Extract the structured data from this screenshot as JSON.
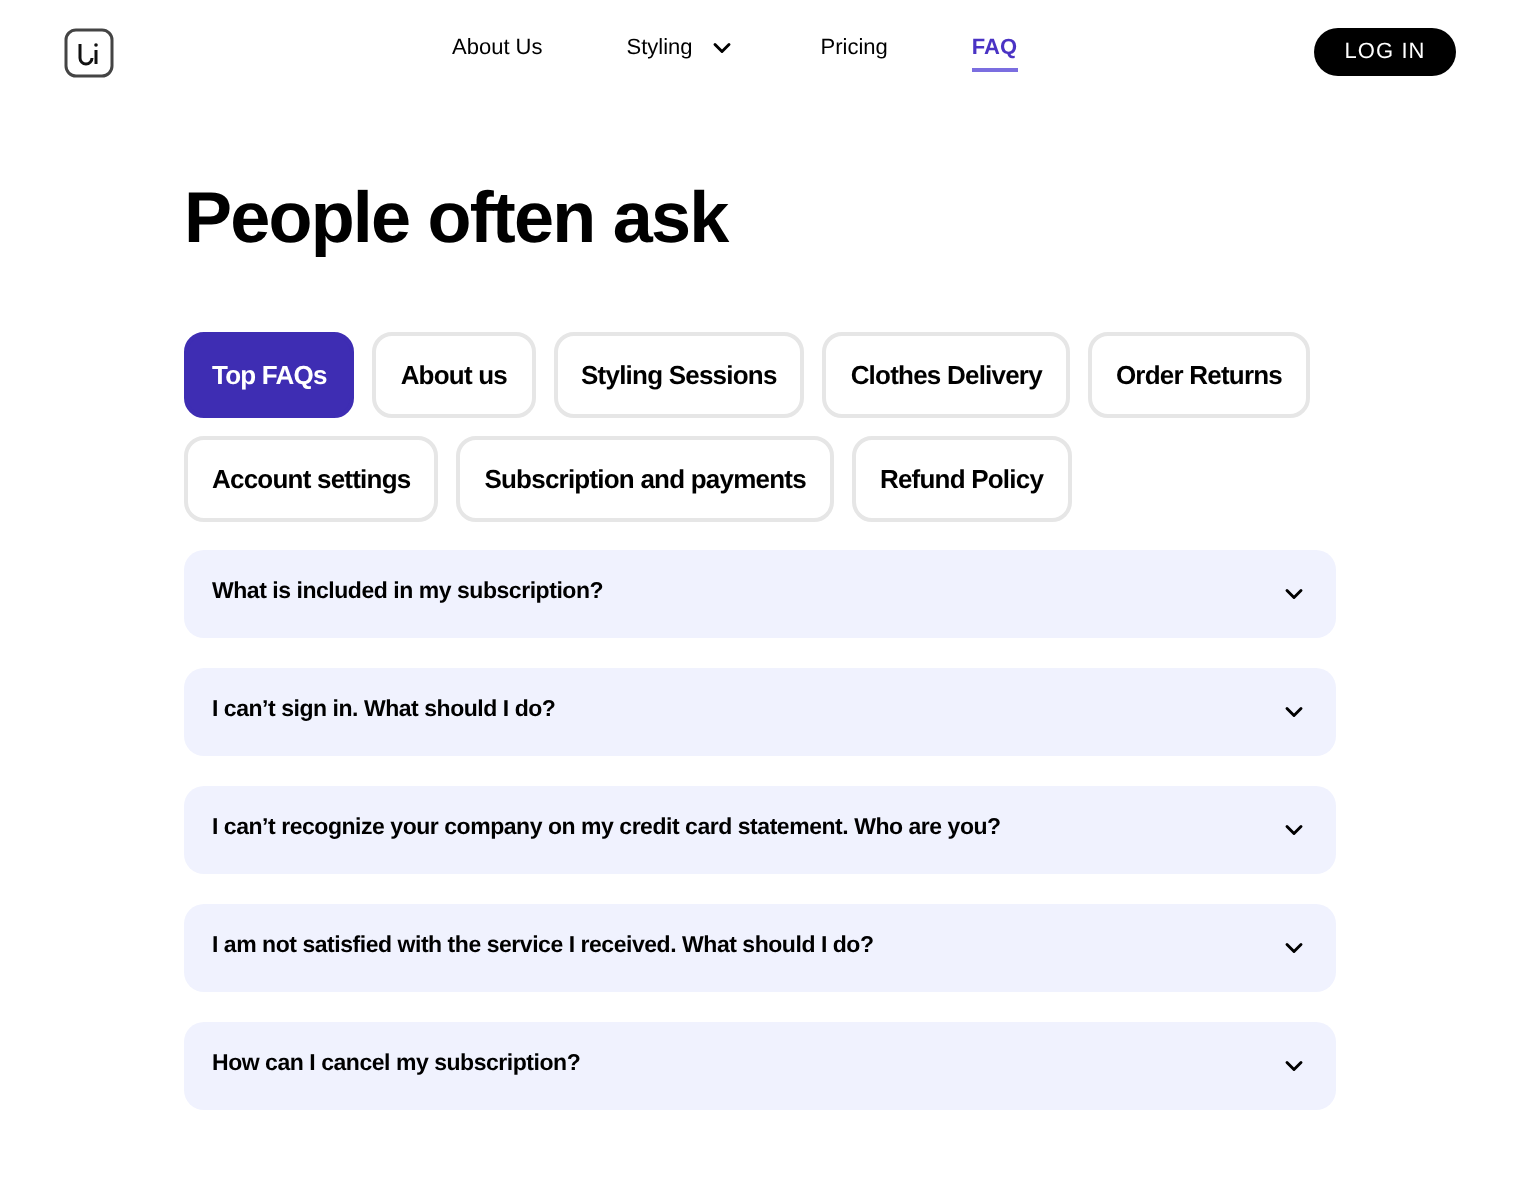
{
  "nav": {
    "links": [
      {
        "label": "About Us",
        "selected": false,
        "dropdown": false
      },
      {
        "label": "Styling",
        "selected": false,
        "dropdown": true
      },
      {
        "label": "Pricing",
        "selected": false,
        "dropdown": false
      },
      {
        "label": "FAQ",
        "selected": true,
        "dropdown": false
      }
    ],
    "login": "LOG IN"
  },
  "heading": "People often ask",
  "tabs": [
    {
      "label": "Top FAQs",
      "selected": true
    },
    {
      "label": "About us",
      "selected": false
    },
    {
      "label": "Styling Sessions",
      "selected": false
    },
    {
      "label": "Clothes Delivery",
      "selected": false
    },
    {
      "label": "Order Returns",
      "selected": false
    },
    {
      "label": "Account settings",
      "selected": false
    },
    {
      "label": "Subscription and payments",
      "selected": false
    },
    {
      "label": "Refund Policy",
      "selected": false
    }
  ],
  "faqs": [
    {
      "question": "What is included in my subscription?",
      "expanded": false
    },
    {
      "question": "I can’t sign in. What should I do?",
      "expanded": false
    },
    {
      "question": "I can’t recognize your company on my credit card statement. Who are you?",
      "expanded": false
    },
    {
      "question": "I am not satisfied with the service I received. What should I do?",
      "expanded": false
    },
    {
      "question": "How can I cancel my subscription?",
      "expanded": false
    }
  ]
}
